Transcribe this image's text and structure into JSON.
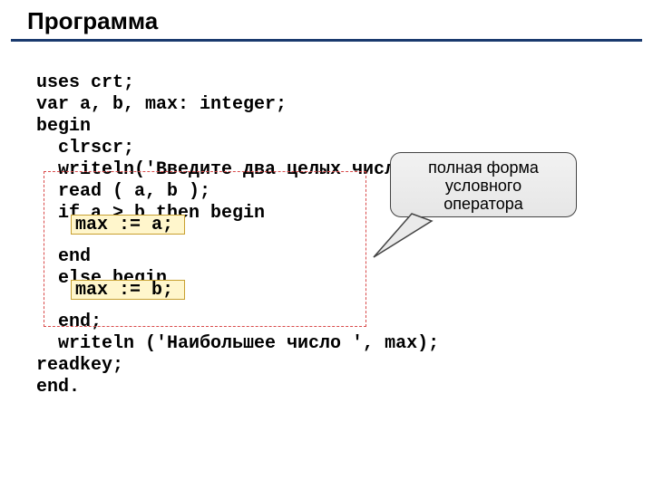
{
  "title": "Программа",
  "code": {
    "l1": "uses crt;",
    "l2": "var a, b, max: integer;",
    "l3": "begin",
    "l4": "  clrscr;",
    "l5": "  writeln('Введите два целых числа');",
    "l6": "  read ( a, b );",
    "l7": "  if a > b then begin",
    "l8": "   ",
    "l9": "  end",
    "l10": "  else begin",
    "l11": "   ",
    "l12": "  end;",
    "l13": "  writeln ('Наибольшее число ', max);",
    "l14": "readkey;",
    "l15": "end."
  },
  "assign1": "max := a;",
  "assign2": "max := b;",
  "callout": {
    "line1": "полная форма",
    "line2": "условного",
    "line3": "оператора"
  }
}
